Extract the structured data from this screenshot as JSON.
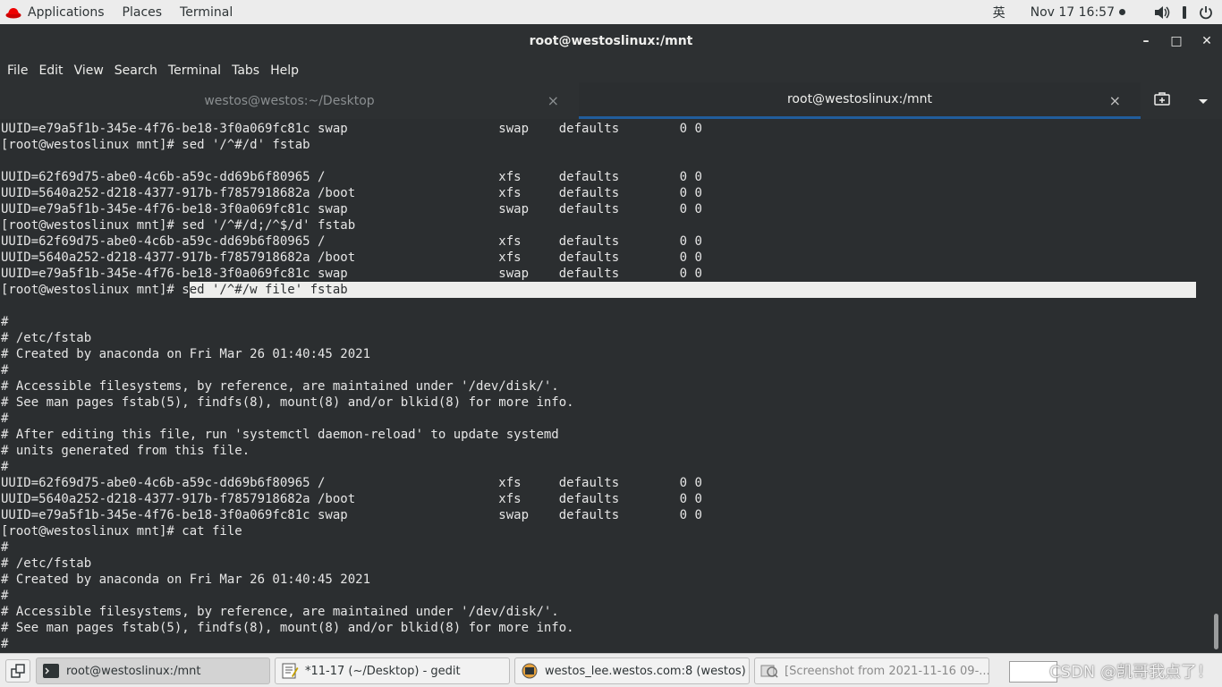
{
  "top_bar": {
    "applications": "Applications",
    "places": "Places",
    "terminal": "Terminal",
    "input_method": "英",
    "clock": "Nov 17  16:57"
  },
  "window": {
    "title": "root@westoslinux:/mnt",
    "minimize": "–",
    "maximize": "□",
    "close": "✕"
  },
  "menubar": [
    "File",
    "Edit",
    "View",
    "Search",
    "Terminal",
    "Tabs",
    "Help"
  ],
  "tabs": [
    {
      "label": "westos@westos:~/Desktop",
      "close": "×"
    },
    {
      "label": "root@westoslinux:/mnt",
      "close": "×"
    }
  ],
  "terminal": {
    "lines": [
      "UUID=e79a5f1b-345e-4f76-be18-3f0a069fc81c swap                    swap    defaults        0 0",
      "[root@westoslinux mnt]# sed '/^#/d' fstab",
      "",
      "UUID=62f69d75-abe0-4c6b-a59c-dd69b6f80965 /                       xfs     defaults        0 0",
      "UUID=5640a252-d218-4377-917b-f7857918682a /boot                   xfs     defaults        0 0",
      "UUID=e79a5f1b-345e-4f76-be18-3f0a069fc81c swap                    swap    defaults        0 0",
      "[root@westoslinux mnt]# sed '/^#/d;/^$/d' fstab",
      "UUID=62f69d75-abe0-4c6b-a59c-dd69b6f80965 /                       xfs     defaults        0 0",
      "UUID=5640a252-d218-4377-917b-f7857918682a /boot                   xfs     defaults        0 0",
      "UUID=e79a5f1b-345e-4f76-be18-3f0a069fc81c swap                    swap    defaults        0 0",
      "",
      "",
      "#",
      "# /etc/fstab",
      "# Created by anaconda on Fri Mar 26 01:40:45 2021",
      "#",
      "# Accessible filesystems, by reference, are maintained under '/dev/disk/'.",
      "# See man pages fstab(5), findfs(8), mount(8) and/or blkid(8) for more info.",
      "#",
      "# After editing this file, run 'systemctl daemon-reload' to update systemd",
      "# units generated from this file.",
      "#",
      "UUID=62f69d75-abe0-4c6b-a59c-dd69b6f80965 /                       xfs     defaults        0 0",
      "UUID=5640a252-d218-4377-917b-f7857918682a /boot                   xfs     defaults        0 0",
      "UUID=e79a5f1b-345e-4f76-be18-3f0a069fc81c swap                    swap    defaults        0 0",
      "[root@westoslinux mnt]# cat file",
      "#",
      "# /etc/fstab",
      "# Created by anaconda on Fri Mar 26 01:40:45 2021",
      "#",
      "# Accessible filesystems, by reference, are maintained under '/dev/disk/'.",
      "# See man pages fstab(5), findfs(8), mount(8) and/or blkid(8) for more info.",
      "#"
    ],
    "highlight_line": {
      "prefix": "[root@westoslinux mnt]# s",
      "selected": "ed '/^#/w file' fstab"
    }
  },
  "taskbar": {
    "items": [
      {
        "label": "root@westoslinux:/mnt"
      },
      {
        "label": "*11-17 (~/Desktop) - gedit"
      },
      {
        "label": "westos_lee.westos.com:8 (westos) ..."
      },
      {
        "label": "[Screenshot from 2021-11-16 09-..."
      }
    ],
    "watermark": "CSDN @凯哥我点了！"
  }
}
